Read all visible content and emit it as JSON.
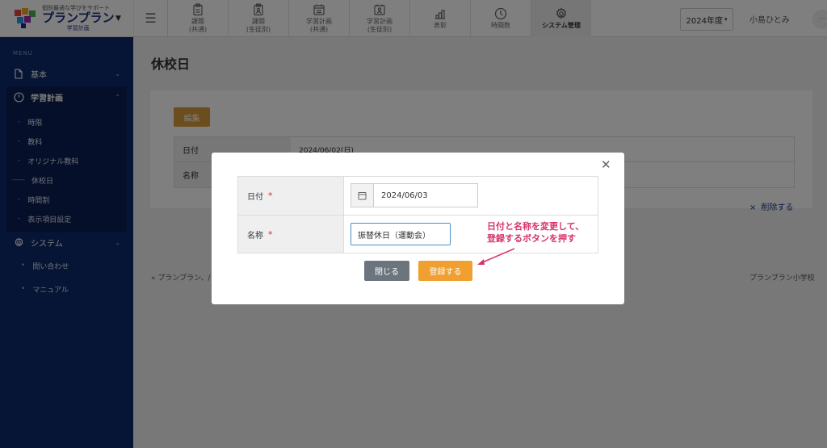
{
  "header": {
    "logo_tagline": "個別最適な学びをサポート",
    "logo_name": "プランプラン",
    "logo_sub": "学習計画",
    "nav": [
      {
        "line1": "課題",
        "line2": "(共通)",
        "icon": "clipboard-icon"
      },
      {
        "line1": "課題",
        "line2": "(生徒別)",
        "icon": "clipboard-user-icon"
      },
      {
        "line1": "学習計画",
        "line2": "(共通)",
        "icon": "calendar-icon"
      },
      {
        "line1": "学習計画",
        "line2": "(生徒別)",
        "icon": "calendar-user-icon"
      },
      {
        "line1": "表彰",
        "line2": "",
        "icon": "podium-icon"
      },
      {
        "line1": "時間数",
        "line2": "",
        "icon": "clock-icon"
      },
      {
        "line1": "システム管理",
        "line2": "",
        "icon": "gear-icon"
      }
    ],
    "year": "2024年度",
    "user": "小島ひとみ",
    "more": "···"
  },
  "sidebar": {
    "menu_label": "MENU",
    "basic": "基本",
    "study_plan": "学習計画",
    "study_plan_items": [
      "時限",
      "教科",
      "オリジナル教科",
      "休校日",
      "時間割",
      "表示項目設定"
    ],
    "system": "システム",
    "contact": "問い合わせ",
    "manual": "マニュアル"
  },
  "main": {
    "title": "休校日",
    "edit_label": "編集",
    "rows": [
      {
        "label": "日付",
        "value": "2024/06/02(日)"
      },
      {
        "label": "名称",
        "value": ""
      }
    ],
    "delete_label": "削除する",
    "breadcrumb": "«  プランプラン、/",
    "school": "プランプラン小学校"
  },
  "modal": {
    "date_label": "日付",
    "date_value": "2024/06/03",
    "name_label": "名称",
    "name_value": "振替休日（運動会）",
    "required_mark": "*",
    "annotation_line1": "日付と名称を変更して、",
    "annotation_line2": "登録するボタンを押す",
    "close_label": "閉じる",
    "register_label": "登録する"
  },
  "colors": {
    "sidebar": "#0d2a6b",
    "edit_button": "#d89a3c",
    "register_button": "#f0a030",
    "close_button": "#6c757d",
    "annotation": "#d6336c"
  }
}
